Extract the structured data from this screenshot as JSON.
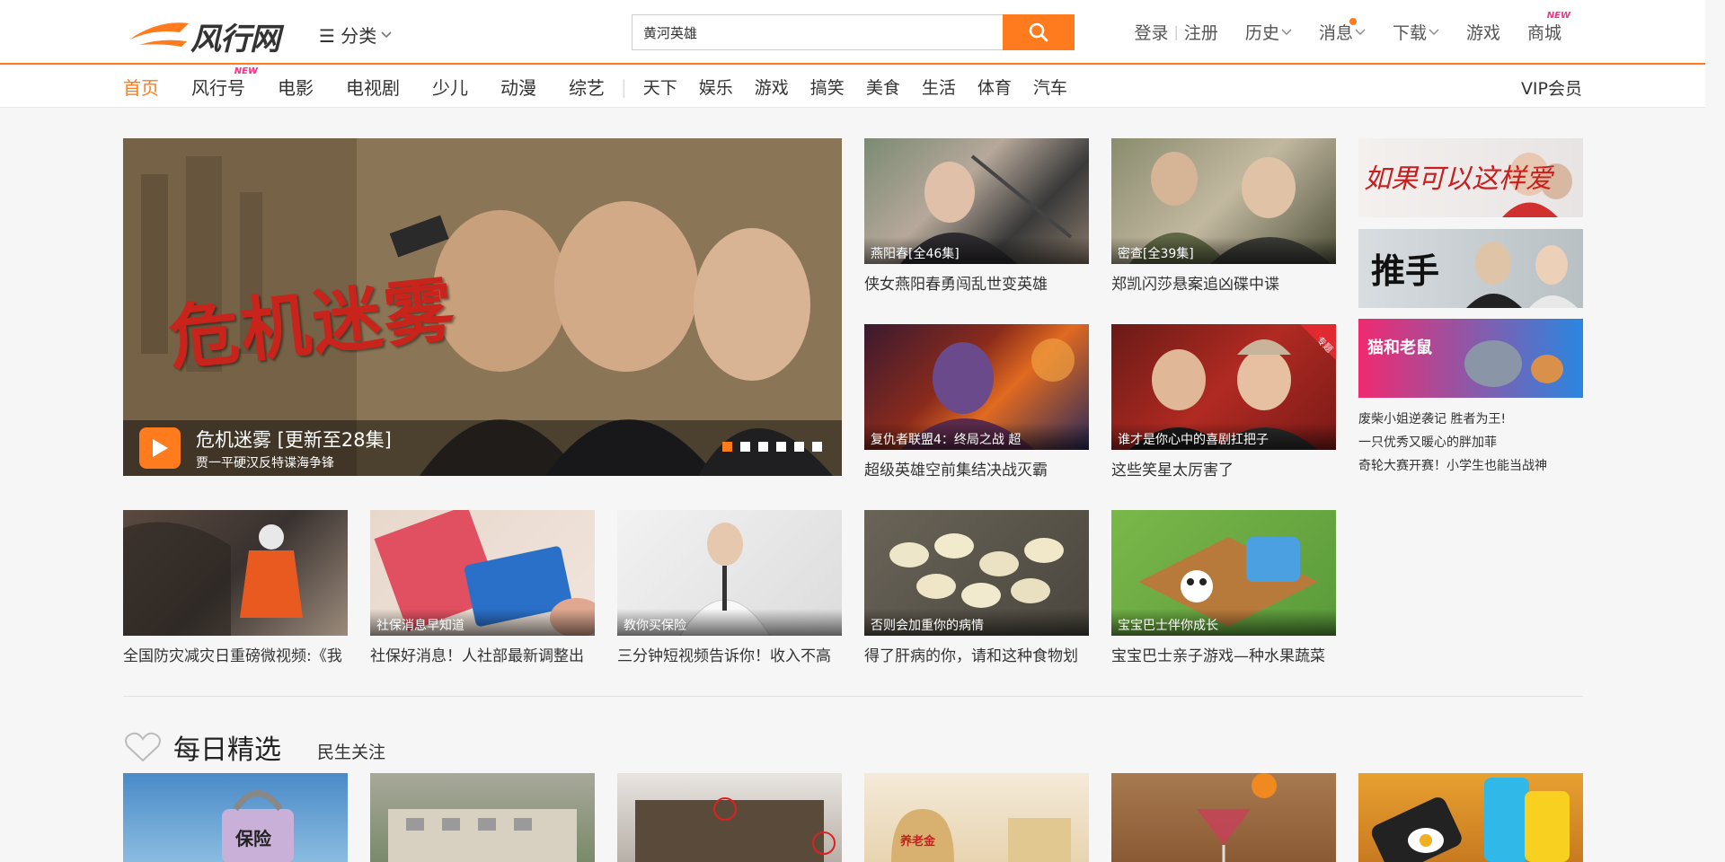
{
  "header": {
    "logo_text": "风行网",
    "category_label": "☰ 分类",
    "search_value": "黄河英雄",
    "links": {
      "login": "登录",
      "register": "注册",
      "history": "历史",
      "messages": "消息",
      "download": "下载",
      "games": "游戏",
      "mall": "商城",
      "new_badge": "NEW"
    },
    "accent_color": "#ff7b1e"
  },
  "nav": {
    "items": [
      "首页",
      "风行号",
      "电影",
      "电视剧",
      "少儿",
      "动漫",
      "综艺",
      "天下",
      "娱乐",
      "游戏",
      "搞笑",
      "美食",
      "生活",
      "体育",
      "汽车"
    ],
    "new_badge": "NEW",
    "vip": "VIP会员"
  },
  "banner": {
    "art_title": "危机迷雾",
    "caption": "危机迷雾  [更新至28集]",
    "subtitle": "贾一平硬汉反特谍海争锋"
  },
  "featured": [
    {
      "cap": "燕阳春[全46集]",
      "title": "侠女燕阳春勇闯乱世变英雄"
    },
    {
      "cap": "密查[全39集]",
      "title": "郑凯闪莎悬案追凶碟中谍"
    },
    {
      "cap": "复仇者联盟4：终局之战 超",
      "title": "超级英雄空前集结决战灭霸"
    },
    {
      "cap": "谁才是你心中的喜剧扛把子",
      "title": "这些笑星太厉害了",
      "corner": "专题"
    }
  ],
  "side_ads": [
    "如果可以这样爱",
    "推手",
    "猫和老鼠"
  ],
  "side_list": [
    "废柴小姐逆袭记 胜者为王!",
    "一只优秀又暖心的胖加菲",
    "奇轮大赛开赛！小学生也能当战神"
  ],
  "row2": [
    {
      "cap": "",
      "title": "全国防灾减灾日重磅微视频:《我"
    },
    {
      "cap": "社保消息早知道",
      "title": "社保好消息！人社部最新调整出"
    },
    {
      "cap": "教你买保险",
      "title": "三分钟短视频告诉你！收入不高"
    },
    {
      "cap": "否则会加重你的病情",
      "title": "得了肝病的你，请和这种食物划"
    },
    {
      "cap": "宝宝巴士伴你成长",
      "title": "宝宝巴士亲子游戏—种水果蔬菜"
    }
  ],
  "section": {
    "title": "每日精选",
    "subtitle": "民生关注"
  },
  "bottom_labels": [
    "保险",
    "养老金"
  ]
}
